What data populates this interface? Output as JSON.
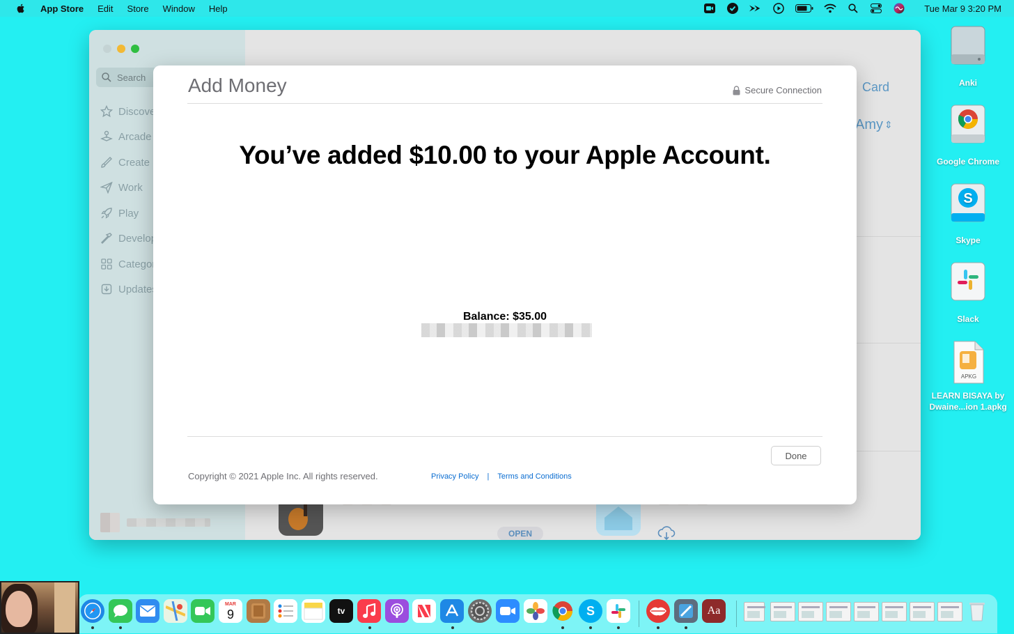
{
  "menubar": {
    "app_name": "App Store",
    "items": [
      "Edit",
      "Store",
      "Window",
      "Help"
    ],
    "clock": "Tue Mar 9  3:20 PM"
  },
  "desktop_icons": [
    "Anki",
    "Google Chrome",
    "Skype",
    "Slack",
    "LEARN BISAYA by Dwaine...ion 1.apkg"
  ],
  "desktop_icon_badge": "APKG",
  "sidebar": {
    "search_placeholder": "Search",
    "items": [
      "Discover",
      "Arcade",
      "Create",
      "Work",
      "Play",
      "Develop",
      "Categories",
      "Updates"
    ]
  },
  "background": {
    "card_link": "Card",
    "account_name": "Amy",
    "open_button": "OPEN"
  },
  "modal": {
    "title": "Add Money",
    "secure_label": "Secure Connection",
    "headline": "You’ve added $10.00 to your Apple Account.",
    "balance": "Balance: $35.00",
    "done_label": "Done",
    "copyright": "Copyright © 2021 Apple Inc. All rights reserved.",
    "privacy_link": "Privacy Policy",
    "separator": "|",
    "terms_link": "Terms and Conditions"
  },
  "dock": {
    "apps": [
      "Safari",
      "Messages",
      "Mail",
      "Maps",
      "FaceTime",
      "Calendar",
      "Notes",
      "Reminders",
      "Stickies",
      "TV",
      "Music",
      "Podcasts",
      "News",
      "App Store",
      "System Preferences",
      "Zoom",
      "Photos",
      "Google Chrome",
      "Skype",
      "Slack",
      "Lips",
      "Xcode",
      "Dictionary"
    ],
    "calendar_month": "MAR",
    "calendar_day": "9",
    "tv_label": "tv",
    "dictionary_label": "Aa"
  },
  "colors": {
    "desktop": "#23eff2",
    "link_blue": "#0a6dd1",
    "sidebar_accent": "#8aa0a6"
  }
}
